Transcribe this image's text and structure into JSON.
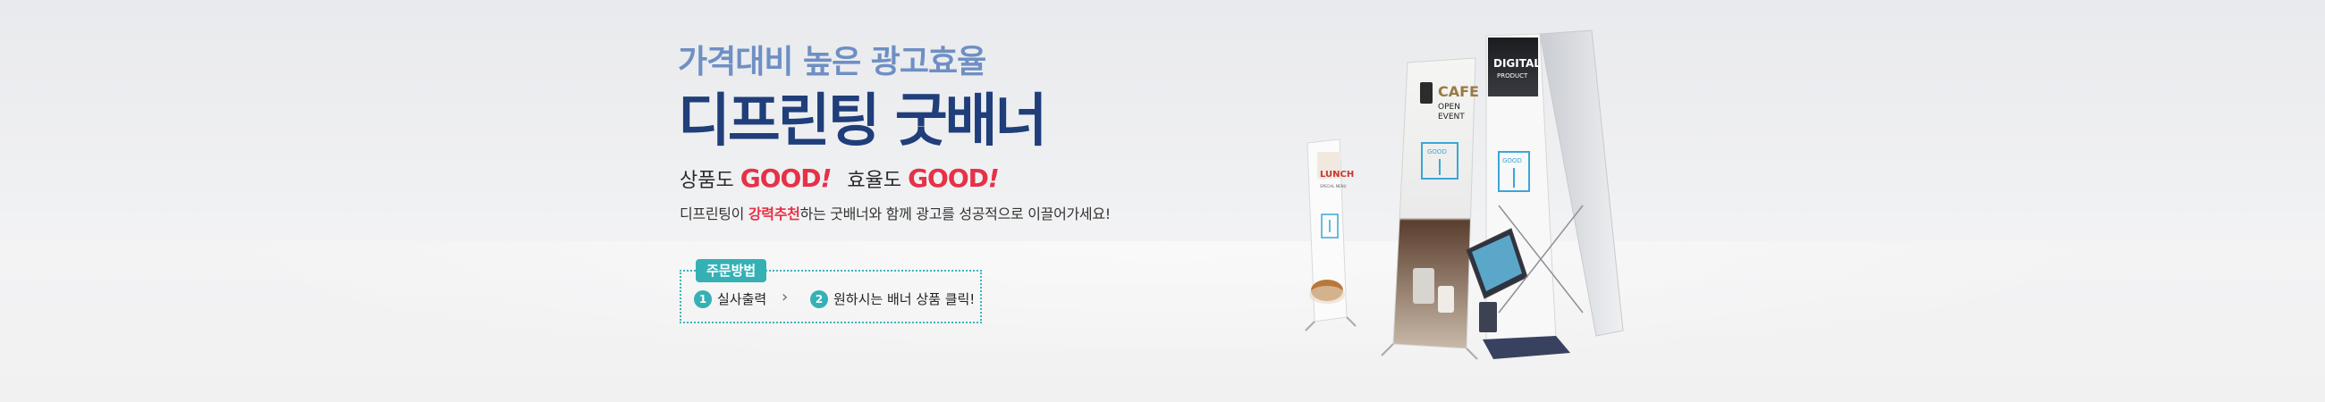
{
  "headline": {
    "subtitle": "가격대비 높은 광고효율",
    "title": "디프린팅 굿배너"
  },
  "tagline": {
    "part1": "상품도 ",
    "good1": "GOOD",
    "excl1": "!",
    "part2": "효율도 ",
    "good2": "GOOD",
    "excl2": "!"
  },
  "description": {
    "before": "디프린팅이 ",
    "highlight": "강력추천",
    "after": "하는 굿배너와 함께 광고를 성공적으로 이끌어가세요!"
  },
  "order": {
    "tag": "주문방법",
    "step1_num": "1",
    "step1_label": "실사출력",
    "arrow": "›",
    "step2_num": "2",
    "step2_label": "원하시는 배너 상품 클릭!"
  },
  "products": {
    "banner1_title": "LUNCH",
    "banner1_sub": "SPECIAL MENU",
    "banner2_title": "CAFE",
    "banner2_sub1": "OPEN",
    "banner2_sub2": "EVENT",
    "banner3_title": "DIGITAL",
    "banner3_sub": "PRODUCT",
    "good_label": "GOOD"
  },
  "colors": {
    "accent_teal": "#35b1b6",
    "title_navy": "#1f3e7a",
    "subtitle_blue": "#6f8fc4",
    "good_red": "#e63147"
  }
}
